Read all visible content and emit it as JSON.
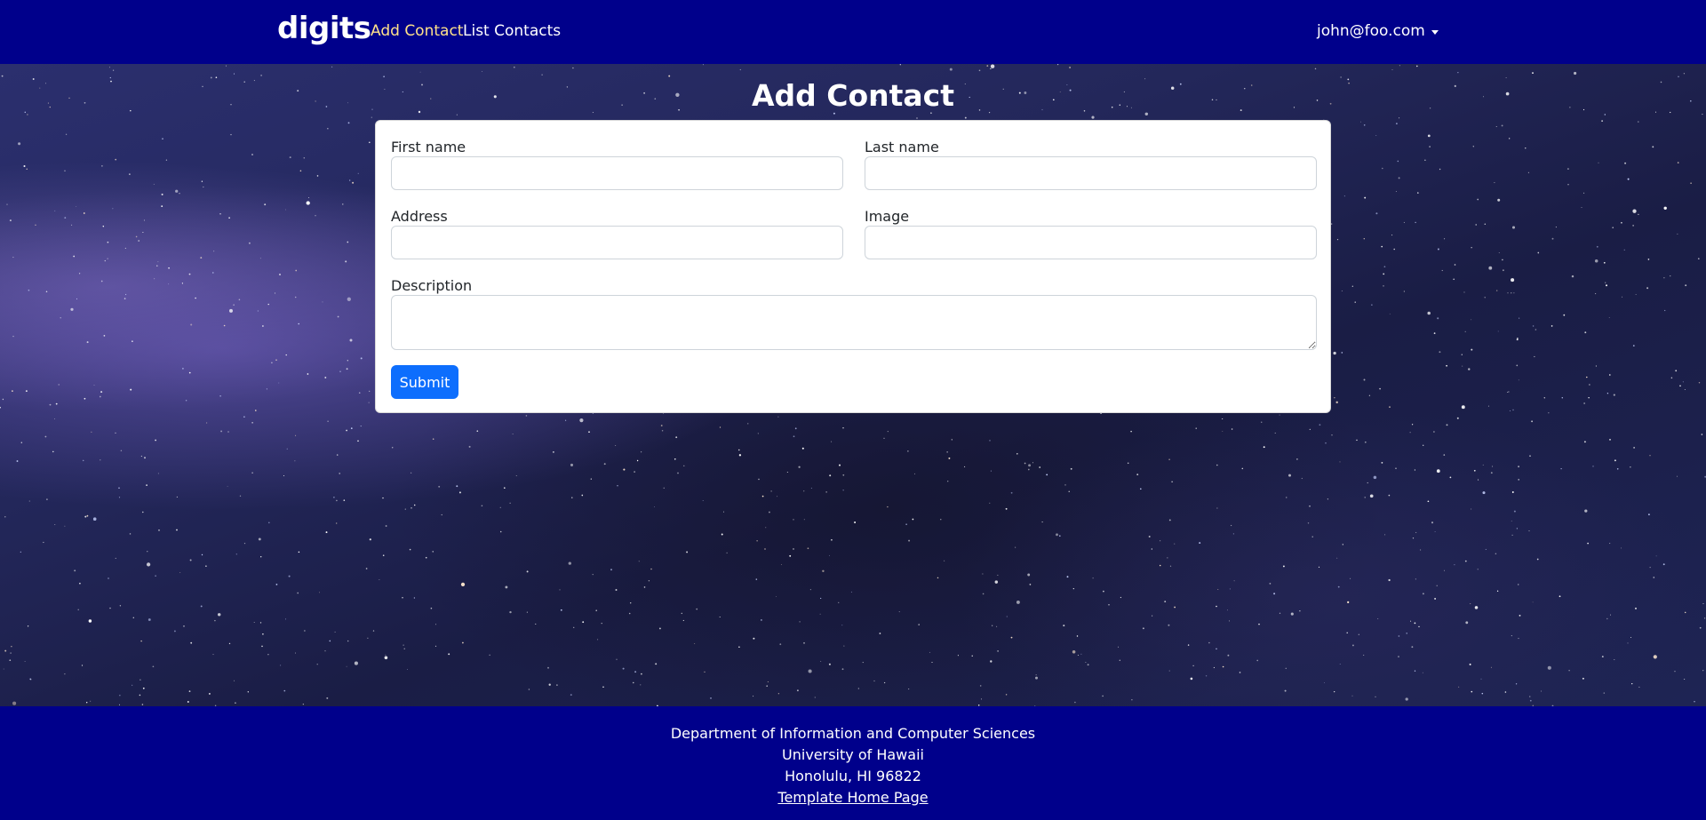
{
  "navbar": {
    "brand": "digits",
    "links": [
      {
        "label": "Add Contact",
        "active": true
      },
      {
        "label": "List Contacts",
        "active": false
      }
    ],
    "user": "john@foo.com",
    "background_color": "#00008b",
    "active_link_color": "#ffe28a"
  },
  "page": {
    "title": "Add Contact"
  },
  "form": {
    "first_name": {
      "label": "First name",
      "value": ""
    },
    "last_name": {
      "label": "Last name",
      "value": ""
    },
    "address": {
      "label": "Address",
      "value": ""
    },
    "image": {
      "label": "Image",
      "value": ""
    },
    "description": {
      "label": "Description",
      "value": ""
    },
    "submit_label": "Submit",
    "submit_color": "#0d6efd"
  },
  "footer": {
    "lines": [
      "Department of Information and Computer Sciences",
      "University of Hawaii",
      "Honolulu, HI 96822"
    ],
    "link_label": "Template Home Page",
    "background_color": "#00008b"
  }
}
